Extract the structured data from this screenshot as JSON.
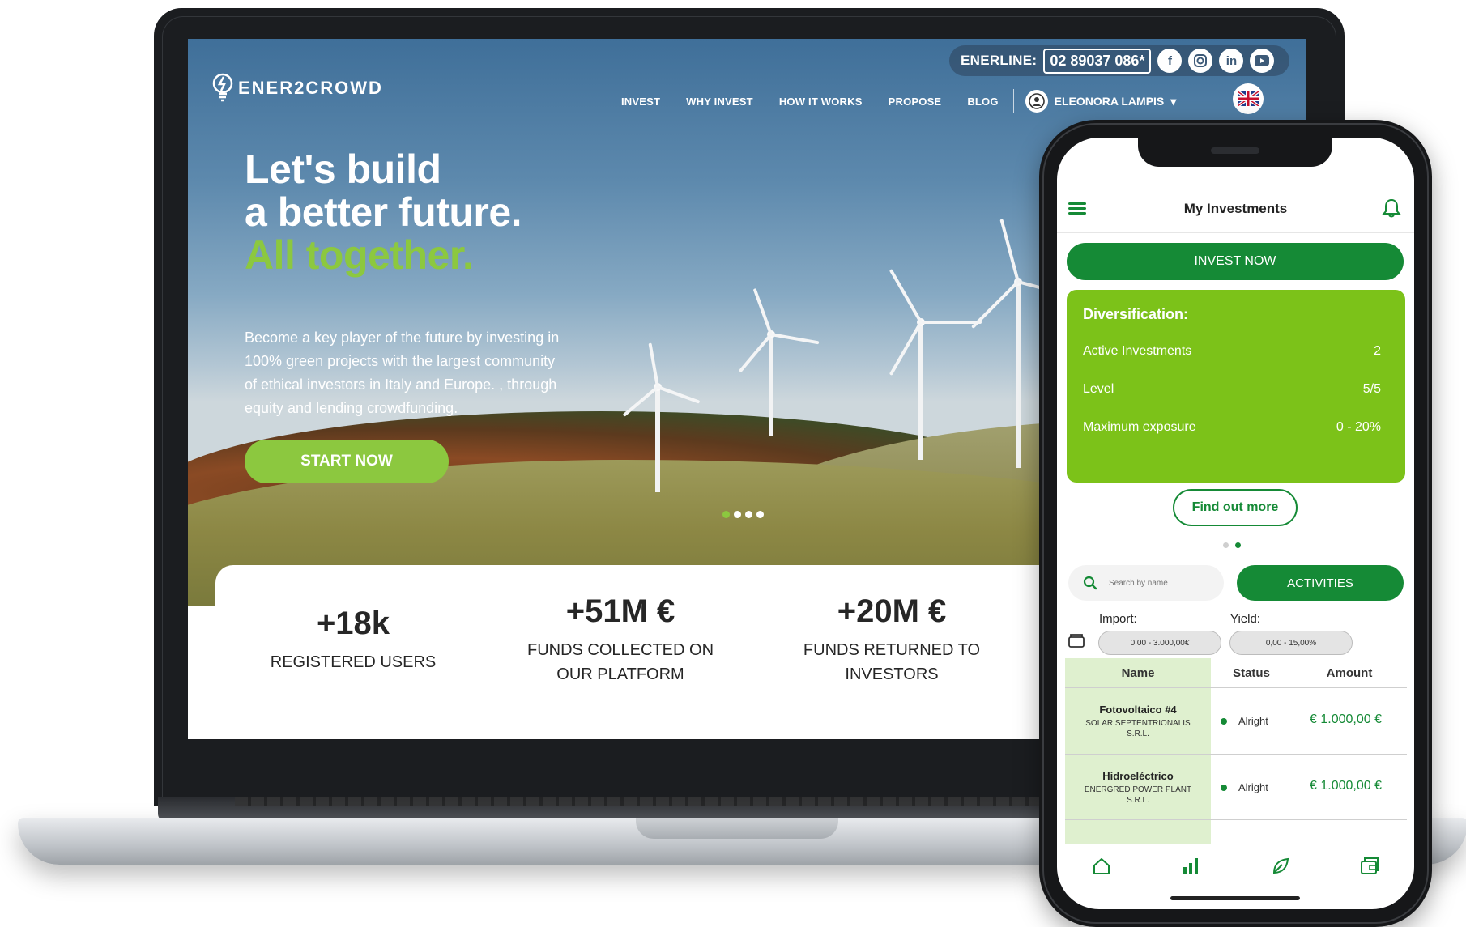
{
  "desktop": {
    "topbar": {
      "enerline_label": "ENERLINE:",
      "enerline_number": "02 89037 086*"
    },
    "social": [
      "facebook-icon",
      "instagram-icon",
      "linkedin-icon",
      "youtube-icon"
    ],
    "logo_text": "ENER2CROWD",
    "nav": [
      "INVEST",
      "WHY INVEST",
      "HOW IT WORKS",
      "PROPOSE",
      "BLOG"
    ],
    "user_name": "ELEONORA LAMPIS",
    "hero": {
      "line1": "Let's build",
      "line2": "a better future.",
      "line3": "All together.",
      "subtext": "Become a key player of the future by investing in 100% green projects with the largest community of ethical investors in Italy and Europe. , through equity and lending crowdfunding.",
      "cta": "START NOW",
      "slides": 4,
      "active_slide": 1
    },
    "stats": [
      {
        "value": "+18k",
        "label": "REGISTERED USERS"
      },
      {
        "value": "+51M €",
        "label": "FUNDS COLLECTED ON OUR PLATFORM"
      },
      {
        "value": "+20M €",
        "label": "FUNDS RETURNED TO INVESTORS"
      }
    ]
  },
  "mobile": {
    "title": "My Investments",
    "invest_now": "INVEST NOW",
    "diversification": {
      "title": "Diversification:",
      "rows": [
        {
          "label": "Active Investments",
          "value": "2"
        },
        {
          "label": "Level",
          "value": "5/5"
        },
        {
          "label": "Maximum exposure",
          "value": "0 - 20%"
        }
      ]
    },
    "find_out_more": "Find out more",
    "search_placeholder": "Search by name",
    "activities": "ACTIVITIES",
    "filters": {
      "import_label": "Import:",
      "import_value": "0,00 - 3.000,00€",
      "yield_label": "Yield:",
      "yield_value": "0,00 - 15,00%"
    },
    "table": {
      "headers": [
        "Name",
        "Status",
        "Amount"
      ],
      "rows": [
        {
          "name": "Fotovoltaico #4",
          "company": "SOLAR SEPTENTRIONALIS S.R.L.",
          "status": "Alright",
          "amount": "€ 1.000,00 €"
        },
        {
          "name": "Hidroeléctrico",
          "company": "ENERGRED POWER PLANT S.R.L.",
          "status": "Alright",
          "amount": "€ 1.000,00 €"
        }
      ]
    },
    "tabbar": [
      "home-icon",
      "chart-icon",
      "leaf-icon",
      "wallet-icon"
    ],
    "colors": {
      "primary": "#158a36",
      "accent": "#7cc219",
      "desktop_accent": "#8cc83f"
    }
  }
}
